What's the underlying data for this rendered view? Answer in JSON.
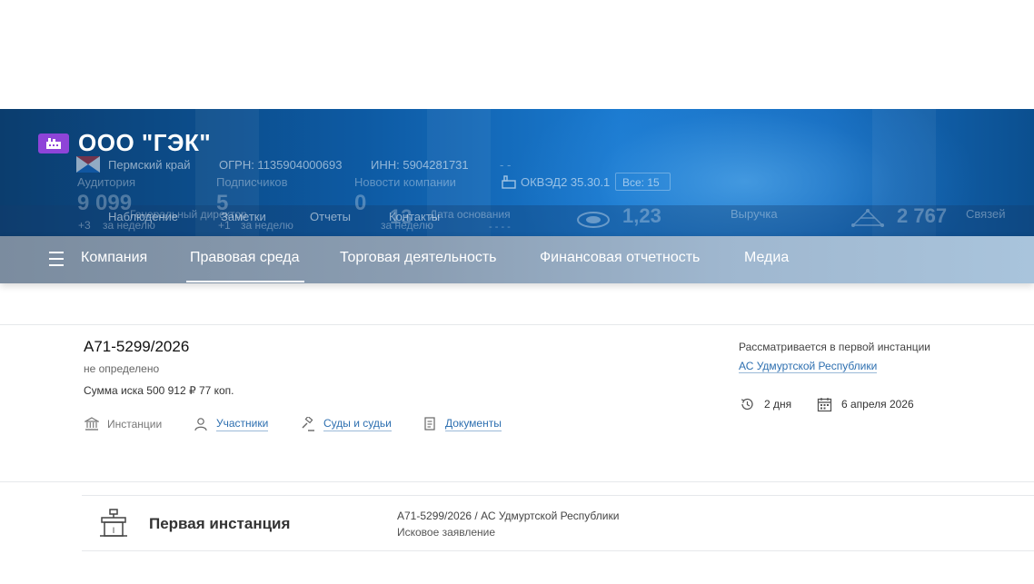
{
  "company": {
    "name": "ООО \"ГЭК\"",
    "region": "Пермский край",
    "ogrn": "ОГРН: 1135904000693",
    "inn": "ИНН: 5904281731",
    "okved": "ОКВЭД2 35.30.1",
    "okved_all": "Все: 15",
    "dash": "- -"
  },
  "stats": {
    "audience_label": "Аудитория",
    "audience_value": "9 099",
    "subscribers_label": "Подписчиков",
    "subscribers_value": "5",
    "news_label": "Новости компании",
    "news_value": "0",
    "week_1": "за неделю",
    "week_2": "за неделю",
    "week_3": "за неделю",
    "plus_1": "+3",
    "plus_2": "+1",
    "general_label": "Генеральный директор",
    "founded_label": "Дата основания",
    "founded_value": "- - - -",
    "contacts_value": "13",
    "rating_value": "1,23",
    "revenue_label": "Выручка",
    "links_value": "2 767",
    "links_label": "Связей"
  },
  "actions": {
    "observe": "Наблюдение",
    "notes": "Заметки",
    "reports": "Отчеты",
    "contacts": "Контакты"
  },
  "nav": {
    "items": [
      "Компания",
      "Правовая среда",
      "Торговая деятельность",
      "Финансовая отчетность",
      "Медиа"
    ],
    "active": "Правовая среда"
  },
  "case": {
    "number": "А71-5299/2026",
    "status": "не определено",
    "sum": "Сумма иска 500 912 ₽ 77 коп.",
    "tabs": {
      "instances": "Инстанции",
      "participants": "Участники",
      "courts": "Суды и судьи",
      "documents": "Документы"
    },
    "instance_note": "Рассматривается в первой инстанции",
    "court": "АС Удмуртской Республики",
    "duration": "2 дня",
    "date": "6 апреля 2026"
  },
  "first_instance": {
    "title": "Первая инстанция",
    "ref": "А71-5299/2026 / АС Удмуртской Республики",
    "type": "Исковое заявление"
  },
  "colors": {
    "link": "#2d6fb0",
    "logo": "#8e44d8",
    "banner": "#0d5aa3"
  }
}
